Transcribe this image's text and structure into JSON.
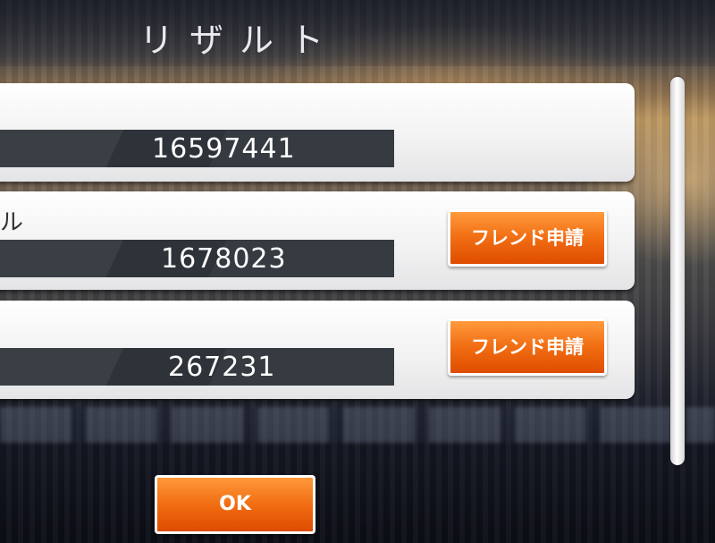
{
  "header": {
    "title": "リザルト"
  },
  "results": [
    {
      "name_fragment": "",
      "score": "16597441",
      "friend_button": null
    },
    {
      "name_fragment": "ル",
      "score": "1678023",
      "friend_button": "フレンド申請"
    },
    {
      "name_fragment": "",
      "score": "267231",
      "friend_button": "フレンド申請"
    }
  ],
  "footer": {
    "ok_label": "OK"
  },
  "colors": {
    "accent_orange": "#f16d12",
    "score_bar": "#2e3339",
    "panel": "#f1f1f2"
  }
}
